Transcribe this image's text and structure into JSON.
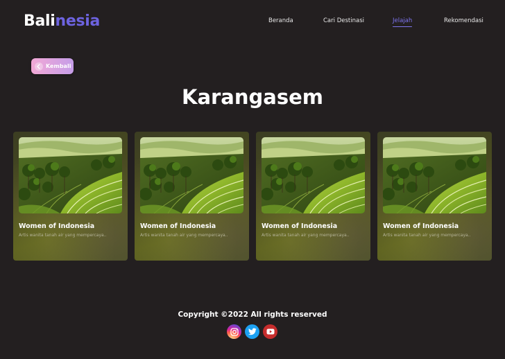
{
  "header": {
    "logo_part1": "Bali",
    "logo_part2": "nesia",
    "logo_colors": {
      "primary": "#ffffff",
      "accent": "#6d63e0"
    }
  },
  "nav": {
    "items": [
      {
        "label": "Beranda",
        "active": false
      },
      {
        "label": "Cari Destinasi",
        "active": false
      },
      {
        "label": "Jelajah",
        "active": true
      },
      {
        "label": "Rekomendasi",
        "active": false
      }
    ],
    "active_color": "#7d74ee"
  },
  "back_button": {
    "label": "Kembali",
    "icon": "arrow-left-icon"
  },
  "page": {
    "title": "Karangasem"
  },
  "cards": [
    {
      "title": "Women of Indonesia",
      "description": "Artis wanita tanah air yang mempercaya..",
      "image": "rice-terrace-photo"
    },
    {
      "title": "Women of Indonesia",
      "description": "Artis wanita tanah air yang mempercaya..",
      "image": "rice-terrace-photo"
    },
    {
      "title": "Women of Indonesia",
      "description": "Artis wanita tanah air yang mempercaya..",
      "image": "rice-terrace-photo"
    },
    {
      "title": "Women of Indonesia",
      "description": "Artis wanita tanah air yang mempercaya..",
      "image": "rice-terrace-photo"
    }
  ],
  "footer": {
    "copyright": "Copyright ©2022 All rights reserved",
    "social": [
      {
        "name": "instagram-icon",
        "color": "#d6249f"
      },
      {
        "name": "twitter-icon",
        "color": "#1da1f2"
      },
      {
        "name": "youtube-icon",
        "color": "#d32f2f"
      }
    ]
  },
  "colors": {
    "background": "#231f20"
  }
}
